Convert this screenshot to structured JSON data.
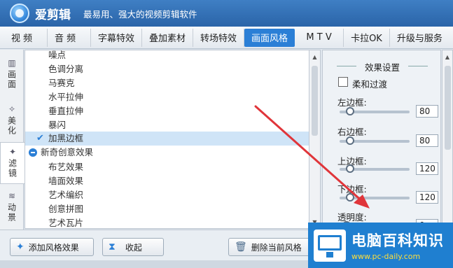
{
  "app": {
    "name": "爱剪辑",
    "slogan": "最易用、强大的视频剪辑软件"
  },
  "tabs": [
    {
      "label": "视 频"
    },
    {
      "label": "音 频"
    },
    {
      "label": "字幕特效"
    },
    {
      "label": "叠加素材"
    },
    {
      "label": "转场特效"
    },
    {
      "label": "画面风格",
      "active": true
    },
    {
      "label": "M T V"
    },
    {
      "label": "卡拉OK"
    },
    {
      "label": "升级与服务"
    }
  ],
  "left_nav": [
    {
      "label": "画面",
      "icon": "grid-icon"
    },
    {
      "label": "美化",
      "icon": "magic-wand-icon"
    },
    {
      "label": "滤镜",
      "icon": "wand-sparkle-icon",
      "active": true
    },
    {
      "label": "动景",
      "icon": "waves-icon"
    }
  ],
  "effects_list": [
    {
      "label": "噪点"
    },
    {
      "label": "色调分离"
    },
    {
      "label": "马赛克"
    },
    {
      "label": "水平拉伸"
    },
    {
      "label": "垂直拉伸"
    },
    {
      "label": "暴闪"
    },
    {
      "label": "加黑边框",
      "selected": true
    },
    {
      "label": "新奇创意效果",
      "group": true
    },
    {
      "label": "布艺效果"
    },
    {
      "label": "墙面效果"
    },
    {
      "label": "艺术编织"
    },
    {
      "label": "创意拼图"
    },
    {
      "label": "艺术瓦片"
    }
  ],
  "settings": {
    "title": "效果设置",
    "smooth_label": "柔和过渡",
    "sliders": [
      {
        "label": "左边框:",
        "value": "80",
        "level": 0.1
      },
      {
        "label": "右边框:",
        "value": "80",
        "level": 0.1
      },
      {
        "label": "上边框:",
        "value": "120",
        "level": 0.1
      },
      {
        "label": "下边框:",
        "value": "120",
        "level": 0.1
      },
      {
        "label": "透明度:",
        "value": "0",
        "level": 0.05
      }
    ]
  },
  "buttons": {
    "add_style": "添加风格效果",
    "collapse": "收起",
    "delete_style": "删除当前风格"
  },
  "watermark": {
    "title": "电脑百科知识",
    "url": "www.pc-daily.com"
  },
  "colors": {
    "accent": "#2b7fd6",
    "titlebar": "#2a64a8",
    "annotation_arrow": "#e0353a"
  }
}
